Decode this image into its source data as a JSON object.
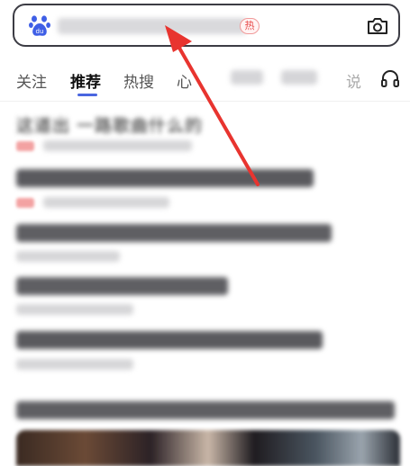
{
  "search": {
    "hot_badge": "热"
  },
  "tabs": [
    {
      "label": "关注"
    },
    {
      "label": "推荐"
    },
    {
      "label": "热搜"
    },
    {
      "label": "心"
    },
    {
      "label": "说"
    }
  ],
  "feed": {
    "first_title": "这道出 一路歌曲什么的"
  },
  "colors": {
    "accent": "#4a66e0",
    "hot": "#e84a4a",
    "arrow": "#e8342f"
  },
  "icons": [
    "baidu-paw-icon",
    "camera-icon",
    "headphone-icon",
    "arrow-annotation"
  ]
}
